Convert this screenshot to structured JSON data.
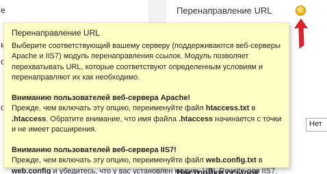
{
  "background": {
    "left_fragments": [
      "e",
      "ыфе",
      "с",
      "о"
    ],
    "setting_label": "Перенаправление URL",
    "info_icon_glyph": "!",
    "select_value": "Нет",
    "bottom_heading": "Настройки ссылок"
  },
  "colors": {
    "tooltip_bg": "#ffffc6",
    "info_icon": "#f8b916",
    "arrow": "#e8202a"
  },
  "tooltip": {
    "title": "Перенаправление URL",
    "intro": "Выберите соответствующий вашему серверу (поддерживаются веб-серверы Apache и IIS7) модуль перенаправления ссылок. Модуль позволяет перехватывать URL, которые соответствуют определенным условиям и перенаправляют их как необходимо.",
    "apache": {
      "heading": "Вниманию пользователей веб-сервера Apache!",
      "t1": "Прежде, чем включать эту опцию, переименуйте файл ",
      "file1": "htaccess.txt",
      "t2": " в ",
      "file2": ".htaccess",
      "t3": ". Обратите внимание, что имя файла ",
      "file3": ".htaccess",
      "t4": " начинается с точки и не имеет расширения."
    },
    "iis": {
      "heading": "Вниманию пользователей веб-сервера IIS7!",
      "t1": "Прежде, чем включать эту опцию, переименуйте файл ",
      "file1": "web.config.txt",
      "t2": " в ",
      "file2": "web.config",
      "t3": " и убедитесь, что у вас установлен модуль URL Rewrite для IIS7."
    }
  }
}
